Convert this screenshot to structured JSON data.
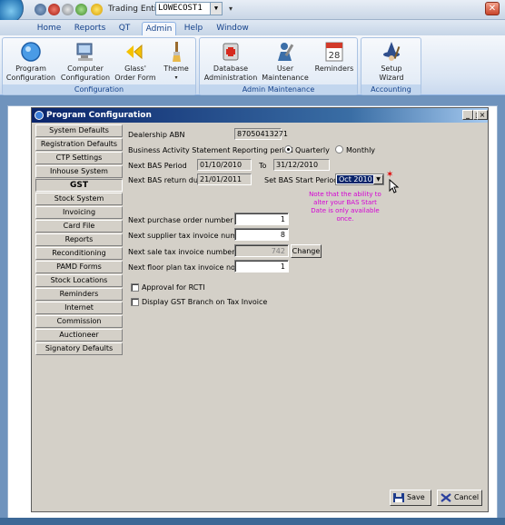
{
  "quick_access": {
    "trading_label": "Trading Entity",
    "trading_value": "LOWECOST1"
  },
  "ribbon": {
    "tabs": [
      "Home",
      "Reports",
      "QT",
      "Admin",
      "Help",
      "Window"
    ],
    "active_tab": "Admin",
    "groups": [
      {
        "label": "Configuration",
        "buttons": [
          {
            "label_1": "Program",
            "label_2": "Configuration",
            "icon": "circle-icon"
          },
          {
            "label_1": "Computer",
            "label_2": "Configuration",
            "icon": "computer-icon"
          },
          {
            "label_1": "Glass'",
            "label_2": "Order Form",
            "icon": "glass-logo-icon"
          },
          {
            "label_1": "Theme",
            "label_2": "",
            "icon": "paintbrush-icon"
          }
        ]
      },
      {
        "label": "Admin Maintenance",
        "buttons": [
          {
            "label_1": "Database",
            "label_2": "Administration",
            "icon": "database-icon"
          },
          {
            "label_1": "User",
            "label_2": "Maintenance",
            "icon": "user-icon"
          },
          {
            "label_1": "Reminders",
            "label_2": "",
            "icon": "calendar-icon"
          }
        ]
      },
      {
        "label": "Accounting Setup",
        "buttons": [
          {
            "label_1": "Setup",
            "label_2": "Wizard",
            "icon": "wizard-icon"
          }
        ]
      }
    ]
  },
  "dialog": {
    "title": "Program Configuration",
    "sidebar": [
      "System Defaults",
      "Registration Defaults",
      "CTP Settings",
      "Inhouse System",
      "GST",
      "Stock System",
      "Invoicing",
      "Card File",
      "Reports",
      "Reconditioning",
      "PAMD Forms",
      "Stock Locations",
      "Reminders",
      "Internet",
      "Commission",
      "Auctioneer",
      "Signatory Defaults"
    ],
    "selected_item": "GST",
    "form": {
      "abn_label": "Dealership ABN",
      "abn_value": "87050413271",
      "bas_period_label": "Business Activity Statement Reporting period",
      "quarterly_label": "Quarterly",
      "monthly_label": "Monthly",
      "bas_period_selected": "Quarterly",
      "next_bas_label": "Next BAS Period",
      "next_bas_from": "01/10/2010",
      "to_label": "To",
      "next_bas_to": "31/12/2010",
      "next_bas_due_label": "Next BAS return due",
      "next_bas_due": "21/01/2011",
      "set_start_label": "Set BAS Start Period",
      "set_start_value": "Oct 2010",
      "note": "Note that the ability to alter your BAS Start Date is only available once.",
      "po_label": "Next purchase order number",
      "po_value": "1",
      "supplier_label": "Next supplier tax invoice number",
      "supplier_value": "8",
      "sale_label": "Next sale tax invoice number",
      "sale_value": "742",
      "change_label": "Change",
      "floor_label": "Next floor plan tax invoice no",
      "floor_value": "1",
      "rcti_label": "Approval for RCTI",
      "gst_branch_label": "Display GST Branch on Tax Invoice"
    },
    "save_label": "Save",
    "cancel_label": "Cancel"
  },
  "colors": {
    "title_bar": "#0a246a",
    "note_text": "#d400d4",
    "dialog_face": "#d4d0c8",
    "ribbon_text": "#15428b"
  }
}
